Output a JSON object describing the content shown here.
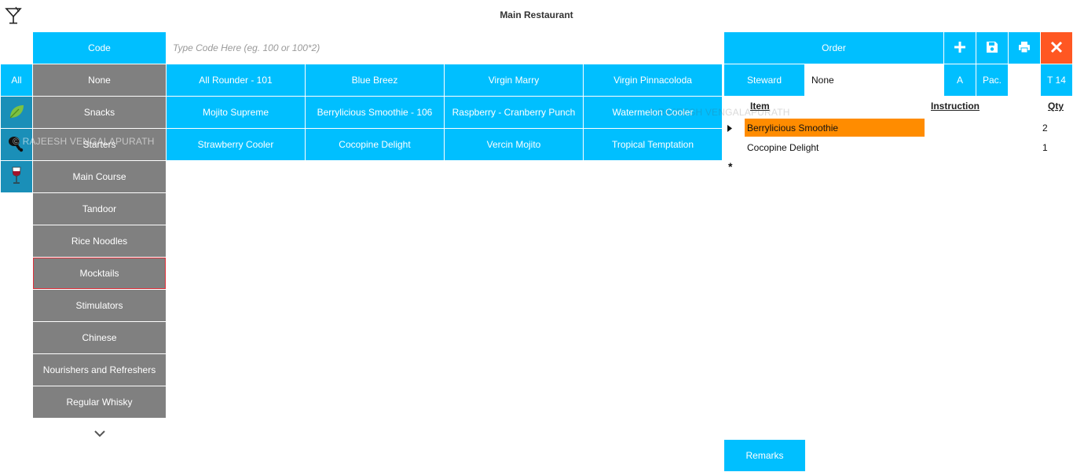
{
  "header": {
    "title": "Main Restaurant",
    "logo_icon": "cocktail-glass-icon"
  },
  "code": {
    "label": "Code",
    "placeholder": "Type Code Here (eg. 100 or 100*2)",
    "value": ""
  },
  "filters": [
    {
      "label": "All"
    },
    {
      "icon": "leaf-icon"
    },
    {
      "icon": "drumstick-icon"
    },
    {
      "icon": "wine-glass-icon"
    }
  ],
  "categories": [
    {
      "label": "None"
    },
    {
      "label": "Snacks"
    },
    {
      "label": "Starters"
    },
    {
      "label": "Main Course"
    },
    {
      "label": "Tandoor"
    },
    {
      "label": "Rice  Noodles"
    },
    {
      "label": "Mocktails",
      "selected": true
    },
    {
      "label": "Stimulators"
    },
    {
      "label": "Chinese"
    },
    {
      "label": "Nourishers and Refreshers"
    },
    {
      "label": "Regular Whisky"
    }
  ],
  "items": [
    [
      "All Rounder - 101",
      "Blue Breez",
      "Virgin Marry",
      "Virgin Pinnacoloda"
    ],
    [
      "Mojito Supreme",
      "Berrylicious Smoothie - 106",
      "Raspberry -  Cranberry Punch",
      "Watermelon Cooler"
    ],
    [
      "Strawberry Cooler",
      "Cocopine Delight",
      "Vercin Mojito",
      "Tropical Temptation"
    ]
  ],
  "order": {
    "header": "Order",
    "steward_label": "Steward",
    "steward_value": "None",
    "mode_label": "A",
    "pack_label": "Pac.",
    "table_label": "T 14",
    "columns": {
      "item": "Item",
      "instruction": "Instruction",
      "qty": "Qty"
    },
    "rows": [
      {
        "item": "Berrylicious Smoothie",
        "instruction": "",
        "qty": "2",
        "selected": true
      },
      {
        "item": "Cocopine Delight",
        "instruction": "",
        "qty": "1"
      }
    ],
    "new_row_marker": "*",
    "remarks_label": "Remarks"
  },
  "watermark": "© RAJEESH VENGALAPURATH",
  "colors": {
    "accent": "#00bfff",
    "category": "#808080",
    "selected_row": "#ff8c00",
    "close": "#ff5722"
  }
}
